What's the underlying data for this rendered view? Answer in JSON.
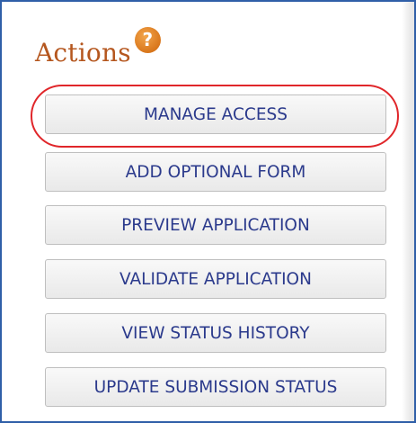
{
  "panel": {
    "title": "Actions",
    "help_icon": "question-mark-icon",
    "help_symbol": "?",
    "accent_color": "#b5571f",
    "highlight_color": "#e0262a"
  },
  "actions": [
    {
      "label": "MANAGE ACCESS",
      "highlighted": true
    },
    {
      "label": "ADD OPTIONAL FORM",
      "highlighted": false
    },
    {
      "label": "PREVIEW APPLICATION",
      "highlighted": false
    },
    {
      "label": "VALIDATE APPLICATION",
      "highlighted": false
    },
    {
      "label": "VIEW STATUS HISTORY",
      "highlighted": false
    },
    {
      "label": "UPDATE SUBMISSION STATUS",
      "highlighted": false
    }
  ]
}
